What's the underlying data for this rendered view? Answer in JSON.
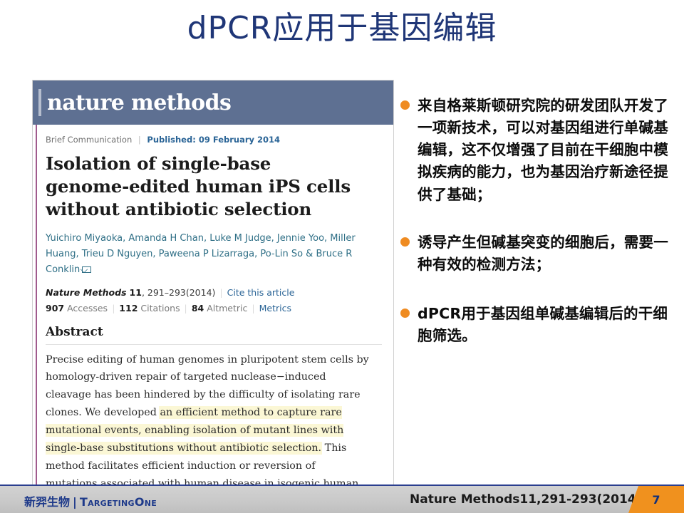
{
  "slide": {
    "title": "dPCR应用于基因编辑",
    "title_color": "#1f3677"
  },
  "article": {
    "journal_logo": "nature methods",
    "header_color": "#5e7092",
    "meta": {
      "type": "Brief Communication",
      "published_label": "Published: 09 February 2014"
    },
    "title": "Isolation of single-base genome-edited human iPS cells without antibiotic selection",
    "authors": "Yuichiro Miyaoka, Amanda H Chan, Luke M Judge, Jennie Yoo, Miller Huang, Trieu D Nguyen, Paweena P Lizarraga, Po-Lin So & Bruce R Conklin",
    "citation": {
      "journal_name": "Nature Methods",
      "volume": "11",
      "pages": ", 291–293(2014)",
      "cite_link": "Cite this article"
    },
    "metrics": {
      "accesses_count": "907",
      "accesses_label": "Accesses",
      "citations_count": "112",
      "citations_label": "Citations",
      "altmetric_count": "84",
      "altmetric_label": "Altmetric",
      "metrics_link": "Metrics"
    },
    "abstract_heading": "Abstract",
    "abstract": {
      "part1": "Precise editing of human genomes in pluripotent stem cells by homology-driven repair of targeted nuclease−induced cleavage has been hindered by the difficulty of isolating rare clones. We developed ",
      "highlighted": "an efficient method to capture rare mutational events, enabling isolation of mutant lines with single-base substitutions without antibiotic selection.",
      "part2": " This method facilitates efficient induction or reversion of mutations associated with human disease in isogenic human induced pluripotent stem cells.",
      "highlight_color": "#fbf7d5"
    }
  },
  "bullets": {
    "dot_color": "#ef8b21",
    "items": [
      {
        "text": "来自格莱斯顿研究院的研发团队开发了一项新技术，可以对基因组进行单碱基编辑，这不仅增强了目前在干细胞中模拟疾病的能力，也为基因治疗新途径提供了基础；"
      },
      {
        "text": "诱导产生但碱基突变的细胞后，需要一种有效的检测方法；"
      },
      {
        "text": "dPCR用于基因组单碱基编辑后的干细胞筛选。"
      }
    ]
  },
  "footer": {
    "logo_cn": "新羿生物",
    "logo_sep": "|",
    "logo_en": "TargetingOne",
    "source": "Nature Methods11,291-293(2014)",
    "page_number": "7",
    "tab_color": "#f0911e",
    "bar_color": "#c9c9c9"
  }
}
